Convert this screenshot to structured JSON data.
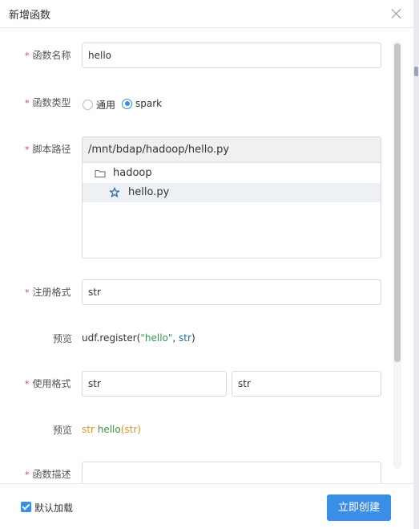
{
  "dialog": {
    "title": "新增函数"
  },
  "form": {
    "func_name": {
      "label": "函数名称",
      "value": "hello"
    },
    "func_type": {
      "label": "函数类型",
      "options": [
        "通用",
        "spark"
      ],
      "selected": "spark"
    },
    "script_path": {
      "label": "脚本路径",
      "value": "/mnt/bdap/hadoop/hello.py",
      "tree": [
        {
          "name": "hadoop",
          "type": "folder"
        },
        {
          "name": "hello.py",
          "type": "file",
          "selected": true
        }
      ]
    },
    "register_format": {
      "label": "注册格式",
      "value": "str"
    },
    "register_preview": {
      "label": "预览",
      "prefix": "udf.register(",
      "name": "\"hello\"",
      "sep": ", ",
      "type": "str",
      "suffix": ")"
    },
    "use_format": {
      "label": "使用格式",
      "value1": "str",
      "value2": "str"
    },
    "use_preview": {
      "label": "预览",
      "ret_type": "str",
      "fn": "hello",
      "open": "(",
      "arg": "str",
      "close": ")"
    },
    "next_field": {
      "label": "函数描述"
    }
  },
  "footer": {
    "default_load_label": "默认加载",
    "default_load_checked": true,
    "create_label": "立即创建"
  },
  "colors": {
    "primary": "#3a8ee6",
    "required": "#e0413c"
  }
}
